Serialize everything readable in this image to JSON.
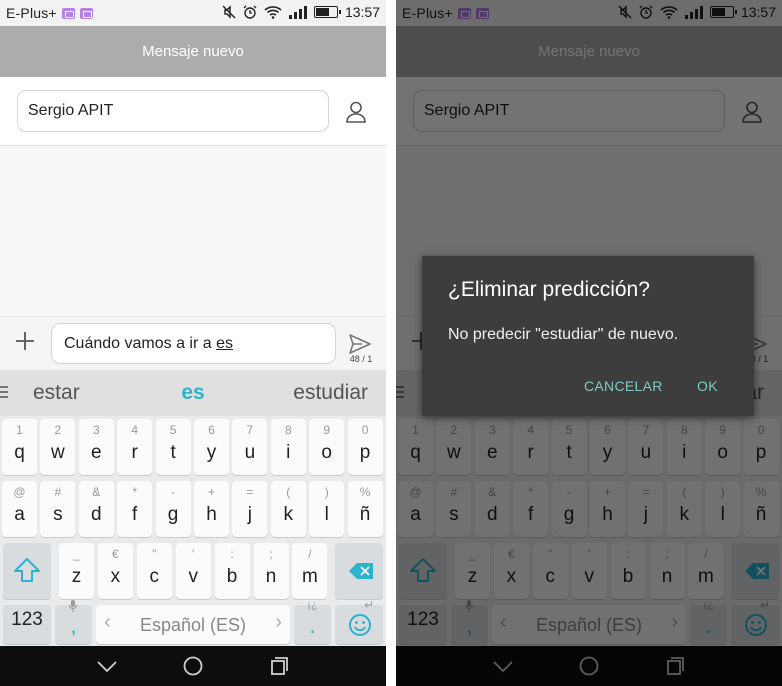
{
  "status_bar": {
    "carrier": "E-Plus+",
    "time": "13:57",
    "battery_level": 0.7
  },
  "title": "Mensaje nuevo",
  "recipient": "Sergio APIT",
  "compose": {
    "text_before": "Cuándo vamos a ir a ",
    "text_underlined": "es",
    "char_count": "48 / 1"
  },
  "suggestions": {
    "left": "estar",
    "center": "es",
    "right": "estudiar"
  },
  "keyboard": {
    "row1": [
      {
        "hint": "1",
        "key": "q"
      },
      {
        "hint": "2",
        "key": "w"
      },
      {
        "hint": "3",
        "key": "e"
      },
      {
        "hint": "4",
        "key": "r"
      },
      {
        "hint": "5",
        "key": "t"
      },
      {
        "hint": "6",
        "key": "y"
      },
      {
        "hint": "7",
        "key": "u"
      },
      {
        "hint": "8",
        "key": "i"
      },
      {
        "hint": "9",
        "key": "o"
      },
      {
        "hint": "0",
        "key": "p"
      }
    ],
    "row2": [
      {
        "hint": "@",
        "key": "a"
      },
      {
        "hint": "#",
        "key": "s"
      },
      {
        "hint": "&",
        "key": "d"
      },
      {
        "hint": "*",
        "key": "f"
      },
      {
        "hint": "-",
        "key": "g"
      },
      {
        "hint": "+",
        "key": "h"
      },
      {
        "hint": "=",
        "key": "j"
      },
      {
        "hint": "(",
        "key": "k"
      },
      {
        "hint": ")",
        "key": "l"
      },
      {
        "hint": "%",
        "key": "ñ"
      }
    ],
    "row3": [
      {
        "hint": "_",
        "key": "z"
      },
      {
        "hint": "€",
        "key": "x"
      },
      {
        "hint": "\"",
        "key": "c"
      },
      {
        "hint": "'",
        "key": "v"
      },
      {
        "hint": ":",
        "key": "b"
      },
      {
        "hint": ";",
        "key": "n"
      },
      {
        "hint": "/",
        "key": "m"
      }
    ],
    "numbers_label": "123",
    "comma": ",",
    "space_label": "Español (ES)",
    "period": ".",
    "period_hint": "¡¿",
    "enter_hint": "↵"
  },
  "dialog": {
    "title": "¿Eliminar predicción?",
    "message": "No predecir \"estudiar\" de nuevo.",
    "cancel": "CANCELAR",
    "ok": "OK"
  },
  "colors": {
    "accent": "#2bb2cf",
    "dialog_button": "#80cbc4",
    "title_bar": "#acacac"
  }
}
